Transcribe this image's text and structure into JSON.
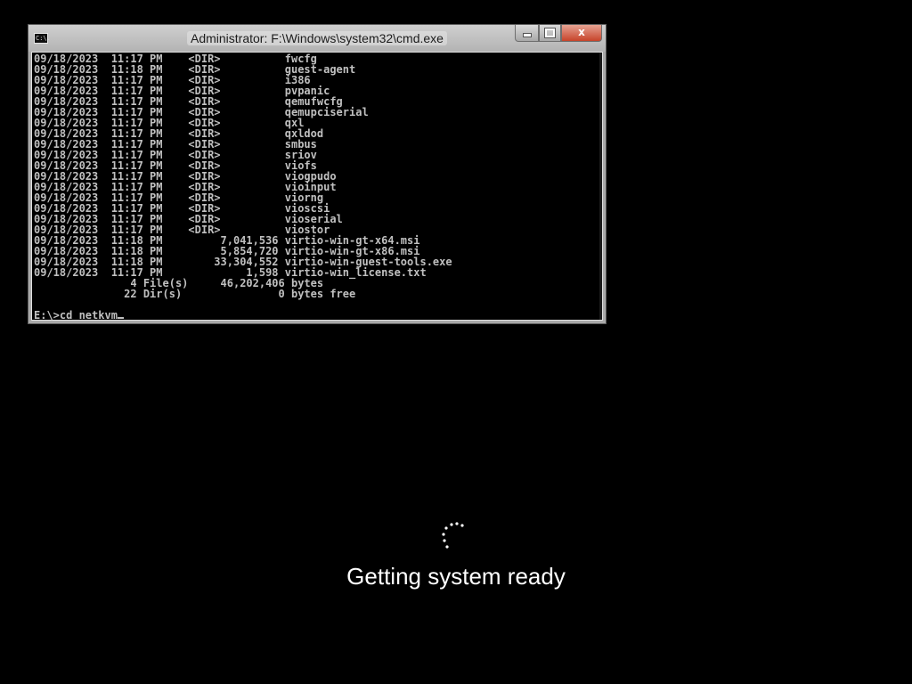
{
  "window": {
    "title": "Administrator: F:\\Windows\\system32\\cmd.exe",
    "icon_label": "C:\\.",
    "buttons": {
      "minimize": "minimize-icon",
      "maximize": "maximize-icon",
      "close": "x"
    }
  },
  "console": {
    "lines": [
      "09/18/2023  11:17 PM    <DIR>          fwcfg",
      "09/18/2023  11:18 PM    <DIR>          guest-agent",
      "09/18/2023  11:17 PM    <DIR>          i386",
      "09/18/2023  11:17 PM    <DIR>          pvpanic",
      "09/18/2023  11:17 PM    <DIR>          qemufwcfg",
      "09/18/2023  11:17 PM    <DIR>          qemupciserial",
      "09/18/2023  11:17 PM    <DIR>          qxl",
      "09/18/2023  11:17 PM    <DIR>          qxldod",
      "09/18/2023  11:17 PM    <DIR>          smbus",
      "09/18/2023  11:17 PM    <DIR>          sriov",
      "09/18/2023  11:17 PM    <DIR>          viofs",
      "09/18/2023  11:17 PM    <DIR>          viogpudo",
      "09/18/2023  11:17 PM    <DIR>          vioinput",
      "09/18/2023  11:17 PM    <DIR>          viorng",
      "09/18/2023  11:17 PM    <DIR>          vioscsi",
      "09/18/2023  11:17 PM    <DIR>          vioserial",
      "09/18/2023  11:17 PM    <DIR>          viostor",
      "09/18/2023  11:18 PM         7,041,536 virtio-win-gt-x64.msi",
      "09/18/2023  11:18 PM         5,854,720 virtio-win-gt-x86.msi",
      "09/18/2023  11:18 PM        33,304,552 virtio-win-guest-tools.exe",
      "09/18/2023  11:17 PM             1,598 virtio-win_license.txt",
      "               4 File(s)     46,202,406 bytes",
      "              22 Dir(s)               0 bytes free"
    ],
    "prompt": "E:\\>cd netkvm"
  },
  "status": {
    "message": "Getting system ready"
  },
  "colors": {
    "background": "#000000",
    "console_text": "#c0c0c0",
    "close_button": "#c7432a"
  }
}
